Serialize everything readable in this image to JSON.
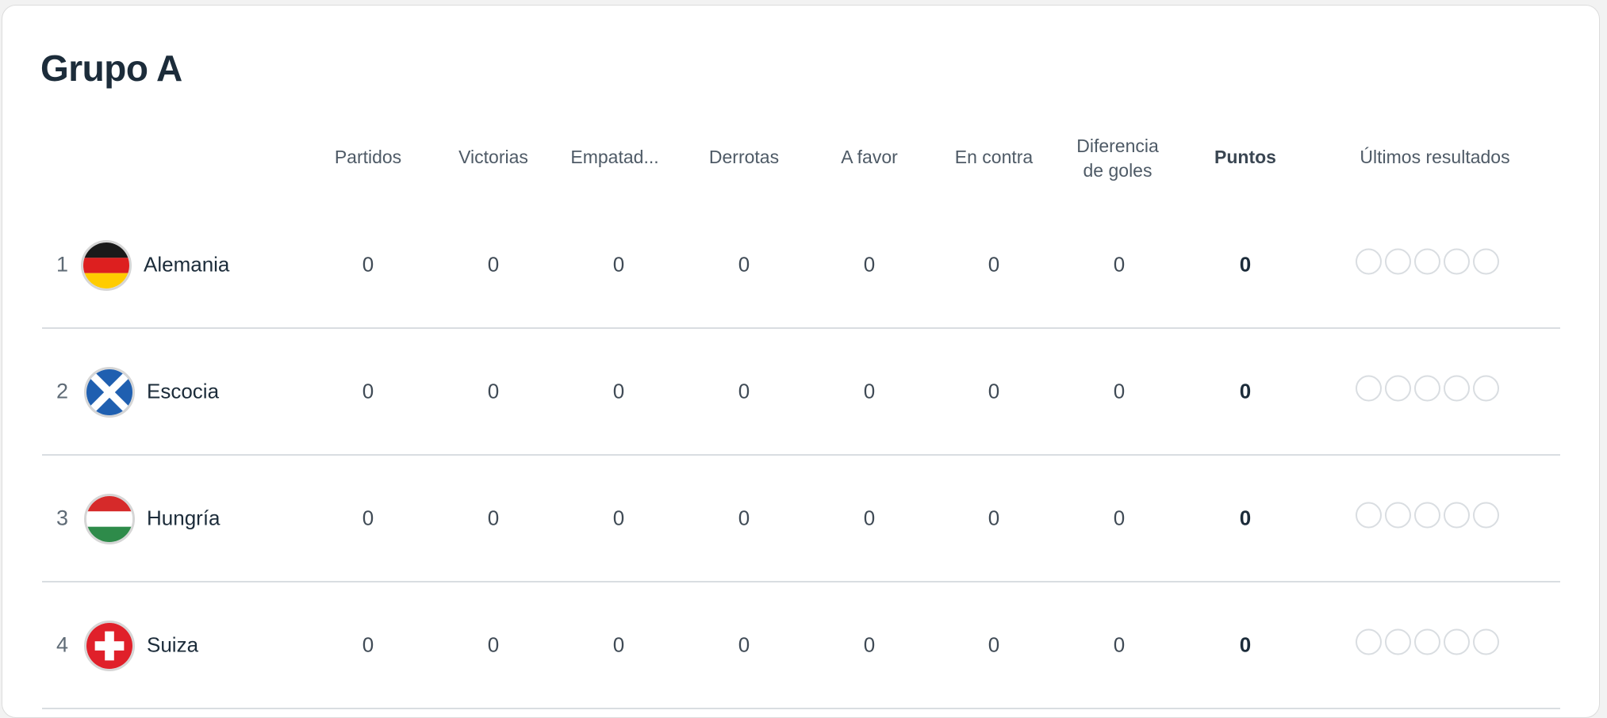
{
  "group": {
    "title": "Grupo A"
  },
  "columns": {
    "played": "Partidos",
    "wins": "Victorias",
    "draws": "Empatad...",
    "losses": "Derrotas",
    "goals_for": "A favor",
    "goals_against": "En contra",
    "goal_diff_line1": "Diferencia",
    "goal_diff_line2": "de goles",
    "points": "Puntos",
    "last_results": "Últimos resultados"
  },
  "teams": [
    {
      "position": "1",
      "name": "Alemania",
      "flag": "germany-flag-icon",
      "played": "0",
      "wins": "0",
      "draws": "0",
      "losses": "0",
      "goals_for": "0",
      "goals_against": "0",
      "goal_diff": "0",
      "points": "0"
    },
    {
      "position": "2",
      "name": "Escocia",
      "flag": "scotland-flag-icon",
      "played": "0",
      "wins": "0",
      "draws": "0",
      "losses": "0",
      "goals_for": "0",
      "goals_against": "0",
      "goal_diff": "0",
      "points": "0"
    },
    {
      "position": "3",
      "name": "Hungría",
      "flag": "hungary-flag-icon",
      "played": "0",
      "wins": "0",
      "draws": "0",
      "losses": "0",
      "goals_for": "0",
      "goals_against": "0",
      "goal_diff": "0",
      "points": "0"
    },
    {
      "position": "4",
      "name": "Suiza",
      "flag": "switzerland-flag-icon",
      "played": "0",
      "wins": "0",
      "draws": "0",
      "losses": "0",
      "goals_for": "0",
      "goals_against": "0",
      "goal_diff": "0",
      "points": "0"
    }
  ],
  "colors": {
    "divider": "#d9dde1",
    "text_primary": "#1c2c3a",
    "text_muted": "#4e5a66"
  }
}
